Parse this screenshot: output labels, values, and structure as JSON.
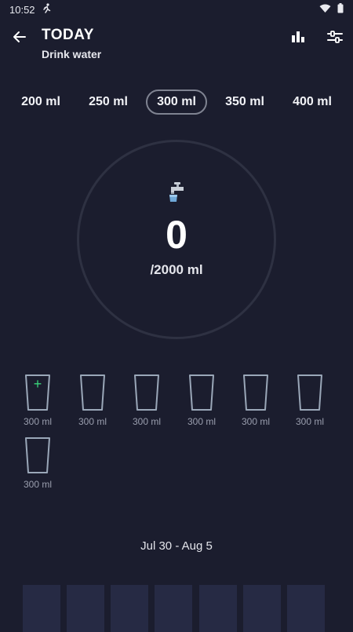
{
  "status": {
    "time": "10:52"
  },
  "header": {
    "title": "TODAY",
    "subtitle": "Drink water"
  },
  "amounts": [
    "200 ml",
    "250 ml",
    "300 ml",
    "350 ml",
    "400 ml"
  ],
  "selected_amount": "300 ml",
  "intake": {
    "current": "0",
    "goal": "/2000 ml"
  },
  "cups": {
    "items": [
      "300 ml",
      "300 ml",
      "300 ml",
      "300 ml",
      "300 ml",
      "300 ml",
      "300 ml"
    ],
    "add_symbol": "+"
  },
  "week": {
    "range": "Jul 30 - Aug 5"
  },
  "colors": {
    "background": "#1b1d2e",
    "ring": "#2e3142",
    "accent_green": "#39d37a",
    "bar": "#262a44",
    "cup_outline": "#9aa7b8"
  },
  "icons": [
    "back-arrow-icon",
    "bar-chart-icon",
    "sliders-icon",
    "faucet-icon",
    "plus-icon",
    "cup-icon",
    "wifi-icon",
    "battery-icon",
    "runner-icon"
  ]
}
